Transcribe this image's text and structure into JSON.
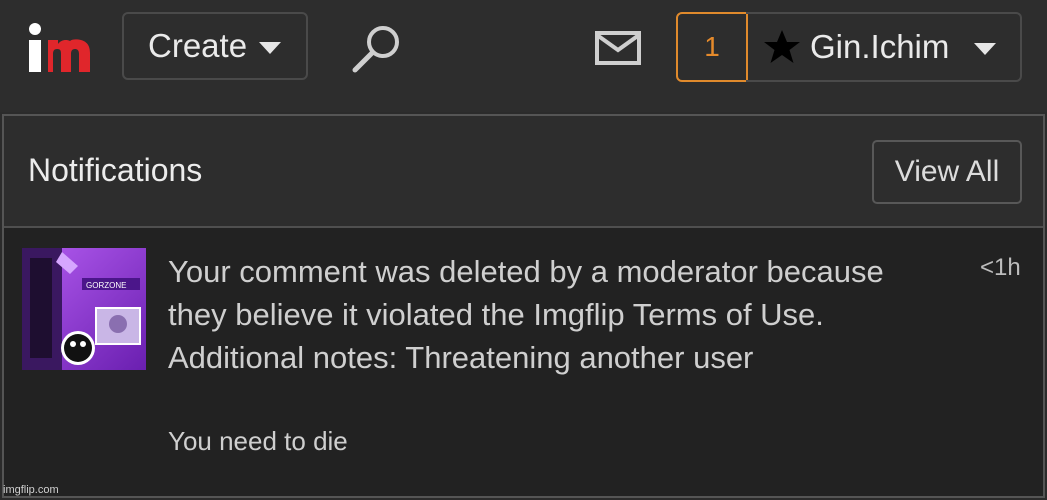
{
  "header": {
    "logo_label": "im",
    "create_label": "Create",
    "notification_count": "1",
    "username": "Gin.Ichim",
    "icons": [
      "logo",
      "chevron-down-icon",
      "search-icon",
      "mail-icon",
      "star-icon"
    ],
    "colors": {
      "accent": "#e58a2b",
      "logo_red": "#e0262b",
      "background": "#2d2d2d"
    }
  },
  "notifications": {
    "title": "Notifications",
    "view_all_label": "View All",
    "items": [
      {
        "message": "Your comment was deleted by a moderator because they believe it violated the Imgflip Terms of Use. Additional notes: Threatening another user",
        "comment": "You need to die",
        "time": "<1h",
        "thumbnail_text": "GORZONE"
      }
    ]
  },
  "watermark": "imgflip.com"
}
